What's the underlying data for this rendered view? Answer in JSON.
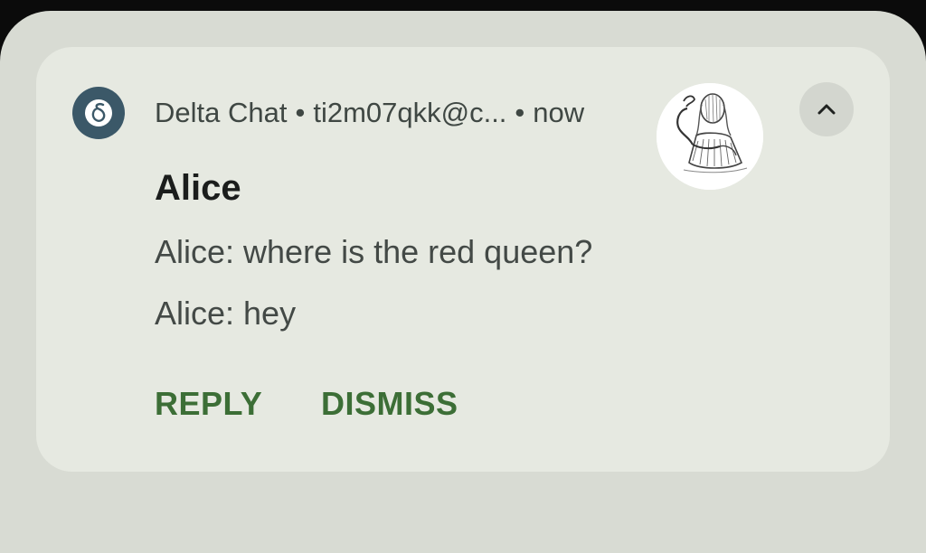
{
  "notification": {
    "app_name": "Delta Chat",
    "separator": "•",
    "account": "ti2m07qkk@c...",
    "time": "now",
    "title": "Alice",
    "messages": [
      "Alice: where is the red queen?",
      "Alice: hey"
    ],
    "actions": {
      "reply_label": "REPLY",
      "dismiss_label": "DISMISS"
    },
    "icons": {
      "app": "delta-chat-icon",
      "avatar": "alice-avatar",
      "expand": "chevron-up-icon"
    }
  },
  "colors": {
    "background": "#0b0b0b",
    "shade": "#d8dbd3",
    "card": "#e6e9e1",
    "app_icon": "#3b5868",
    "action_text": "#3c6e36",
    "title_text": "#1b1d1c",
    "body_text": "#434946"
  }
}
